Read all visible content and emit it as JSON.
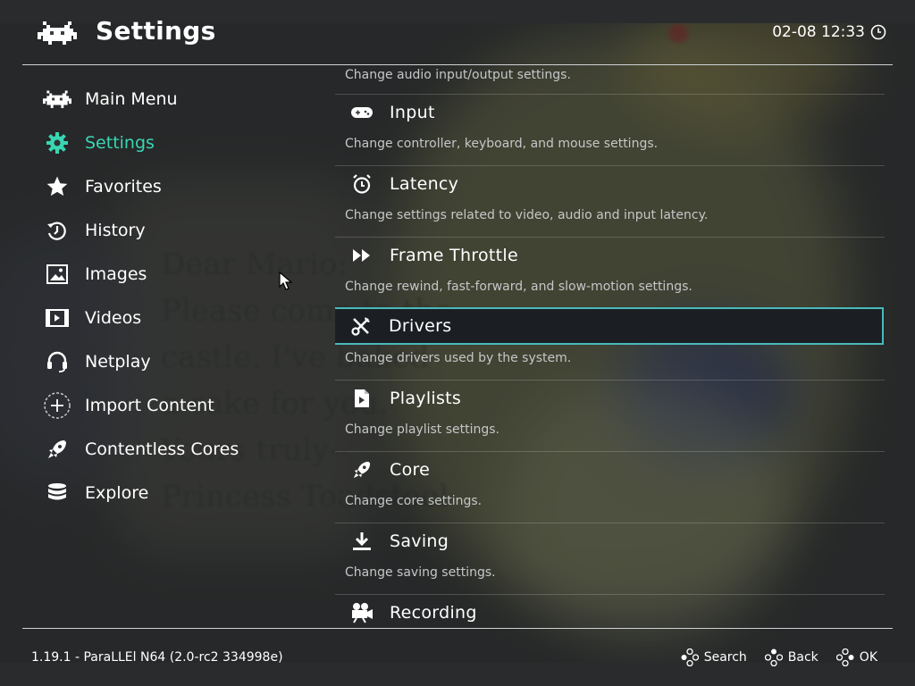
{
  "header": {
    "title": "Settings",
    "clock": "02-08 12:33"
  },
  "sidebar": {
    "items": [
      {
        "label": "Main Menu",
        "icon": "retroarch-invader-icon"
      },
      {
        "label": "Settings",
        "icon": "gear-icon",
        "active": true
      },
      {
        "label": "Favorites",
        "icon": "star-icon"
      },
      {
        "label": "History",
        "icon": "history-icon"
      },
      {
        "label": "Images",
        "icon": "image-icon"
      },
      {
        "label": "Videos",
        "icon": "film-icon"
      },
      {
        "label": "Netplay",
        "icon": "headset-icon"
      },
      {
        "label": "Import Content",
        "icon": "plus-circle-icon"
      },
      {
        "label": "Contentless Cores",
        "icon": "rocket-icon"
      },
      {
        "label": "Explore",
        "icon": "database-icon"
      }
    ]
  },
  "content": {
    "top_description": "Change audio input/output settings.",
    "entries": [
      {
        "label": "Input",
        "description": "Change controller, keyboard, and mouse settings.",
        "icon": "gamepad-icon"
      },
      {
        "label": "Latency",
        "description": "Change settings related to video, audio and input latency.",
        "icon": "stopwatch-icon"
      },
      {
        "label": "Frame Throttle",
        "description": "Change rewind, fast-forward, and slow-motion settings.",
        "icon": "fast-forward-icon"
      },
      {
        "label": "Drivers",
        "description": "Change drivers used by the system.",
        "icon": "tools-icon",
        "selected": true
      },
      {
        "label": "Playlists",
        "description": "Change playlist settings.",
        "icon": "playlist-file-icon"
      },
      {
        "label": "Core",
        "description": "Change core settings.",
        "icon": "rocket-icon"
      },
      {
        "label": "Saving",
        "description": "Change saving settings.",
        "icon": "download-icon"
      },
      {
        "label": "Recording",
        "description": "",
        "icon": "movie-camera-icon"
      }
    ]
  },
  "footer": {
    "version": "1.19.1 - ParaLLEl N64 (2.0-rc2 334998e)",
    "buttons": [
      {
        "label": "Search",
        "icon": "gamepad-buttons-icon"
      },
      {
        "label": "Back",
        "icon": "gamepad-buttons-icon"
      },
      {
        "label": "OK",
        "icon": "gamepad-buttons-icon"
      }
    ]
  },
  "colors": {
    "accent": "#39d6b3",
    "selection_border": "#49b9bb",
    "text": "#ffffff",
    "sublabel": "#c5c7c8"
  }
}
